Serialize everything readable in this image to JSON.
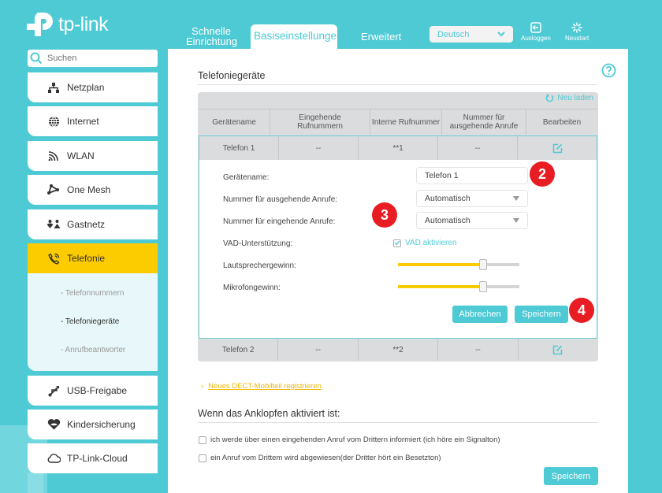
{
  "brand": {
    "name": "tp-link",
    "accent": "#4ecad5",
    "highlight": "#fccb00",
    "badge": "#e81c23"
  },
  "nav": {
    "tabs": [
      {
        "label_line1": "Schnelle",
        "label_line2": "Einrichtung"
      },
      {
        "label": "Basiseinstellungen",
        "active": true
      },
      {
        "label": "Erweitert"
      }
    ],
    "language": "Deutsch",
    "logout_label": "Ausloggen",
    "reboot_label": "Neustart"
  },
  "sidebar": {
    "search_placeholder": "Suchen",
    "items": [
      {
        "label": "Netzplan",
        "icon": "network-map-icon"
      },
      {
        "label": "Internet",
        "icon": "globe-icon"
      },
      {
        "label": "WLAN",
        "icon": "wifi-icon"
      },
      {
        "label": "One Mesh",
        "icon": "mesh-icon"
      },
      {
        "label": "Gastnetz",
        "icon": "guest-icon"
      },
      {
        "label": "Telefonie",
        "icon": "phone-icon",
        "active": true
      },
      {
        "label": "USB-Freigabe",
        "icon": "usb-icon"
      },
      {
        "label": "Kindersicherung",
        "icon": "heart-icon"
      },
      {
        "label": "TP-Link-Cloud",
        "icon": "cloud-icon"
      }
    ],
    "subitems": [
      {
        "label": "- Telefonnummern"
      },
      {
        "label": "- Telefoniegeräte",
        "active": true
      },
      {
        "label": "- Anrufbeantworter"
      }
    ]
  },
  "main": {
    "title": "Telefoniegeräte",
    "reload_label": "Neu laden",
    "table": {
      "headers": [
        "Gerätename",
        "Eingehende Rufnummern",
        "Interne Rufnummer",
        "Nummer für ausgehende Anrufe",
        "Bearbeiten"
      ],
      "rows": [
        {
          "name": "Telefon 1",
          "incoming": "--",
          "internal": "**1",
          "outgoing": "--"
        },
        {
          "name": "Telefon 2",
          "incoming": "--",
          "internal": "**2",
          "outgoing": "--"
        }
      ]
    },
    "edit": {
      "device_name_label": "Gerätename:",
      "device_name_value": "Telefon 1",
      "outgoing_label": "Nummer für ausgehende Anrufe:",
      "outgoing_value": "Automatisch",
      "incoming_label": "Nummer für eingehende Anrufe:",
      "incoming_value": "Automatisch",
      "vad_label": "VAD-Unterstützung:",
      "vad_checkbox_label": "VAD aktivieren",
      "vad_checked": true,
      "speaker_label": "Lautsprechergewinn:",
      "speaker_value_pct": 70,
      "mic_label": "Mikrofongewinn:",
      "mic_value_pct": 70,
      "cancel_label": "Abbrechen",
      "save_label": "Speichern"
    },
    "badges": [
      "2",
      "3",
      "4"
    ],
    "dect_link": "Neues DECT-Mobilteil registrieren",
    "callwaiting": {
      "title": "Wenn das Anklopfen aktiviert ist:",
      "options": [
        {
          "label": "ich werde über einen eingehenden Anruf vom Drittern informiert (ich höre ein Signalton)",
          "checked": false
        },
        {
          "label": "ein Anruf vom Drittem wird abgewiesen(der Dritter hört ein Besetzton)",
          "checked": false
        }
      ],
      "save_label": "Speichern"
    }
  }
}
